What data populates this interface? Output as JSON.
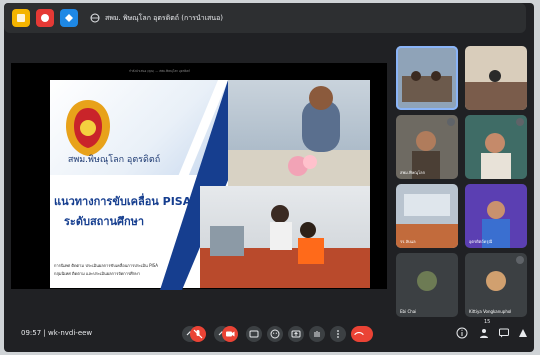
{
  "topbar": {
    "apps": [
      {
        "icon": "app-tile-icon",
        "color": "#f4b400"
      },
      {
        "icon": "app-tile-icon",
        "color": "#e53935"
      },
      {
        "icon": "app-tile-icon",
        "color": "#1e88e5"
      }
    ],
    "title": "สพม. พิษณุโลก อุตรดิตถ์ (การนำเสนอ)"
  },
  "presentation": {
    "caption": "กำลังนำเสนอ (คุณ) — สพม.พิษณุโลก อุตรดิตถ์",
    "slide": {
      "org": "สพม.พิษณุโลก อุตรดิตถ์",
      "title_line1": "แนวทางการขับเคลื่อน PISA",
      "title_line2": "ระดับสถานศึกษา",
      "subtitle_line1": "การนิเทศ ติดตาม ประเมินผลการขับเคลื่อนการประเมิน PISA",
      "subtitle_line2": "กลุ่มนิเทศ ติดตาม และประเมินผลการจัดการศึกษา",
      "accent": "#163e8f"
    }
  },
  "participants": [
    {
      "name": "",
      "active": true
    },
    {
      "name": "",
      "active": false
    },
    {
      "name": "สพม.พิษณุโลก",
      "active": false
    },
    {
      "name": "",
      "active": false
    },
    {
      "name": "รร.ลับแล",
      "active": false
    },
    {
      "name": "อุตรดิตถ์ดรุณี",
      "active": false
    },
    {
      "name": "Ebi Chai",
      "active": false
    },
    {
      "name": "Kittiya Vongkanuphol",
      "active": false
    }
  ],
  "bottom_bar": {
    "time": "09:57",
    "separator": "|",
    "meeting_code": "wk-nvdi-eew",
    "controls": [
      "mic-off-icon",
      "camera-off-icon",
      "captions-icon",
      "emoji-icon",
      "present-icon",
      "raise-hand-icon",
      "more-icon",
      "leave-call-icon"
    ],
    "right": [
      "info-icon",
      "people-icon",
      "chat-icon",
      "activities-icon"
    ],
    "people_badge": "15",
    "colors": {
      "danger": "#ea4335",
      "control_bg": "#3c4043"
    }
  }
}
